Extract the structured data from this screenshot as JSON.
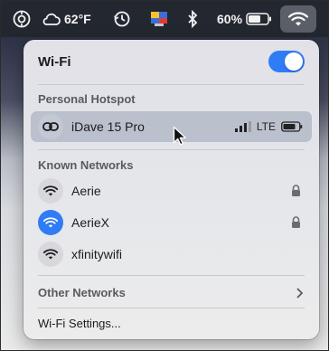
{
  "menubar": {
    "weather": "62°F",
    "battery_percent": "60%",
    "icons": [
      "control-center-icon",
      "weather-cloud-icon",
      "time-machine-icon",
      "menu-app-icon",
      "bluetooth-icon",
      "battery-icon",
      "wifi-icon"
    ]
  },
  "panel": {
    "title": "Wi-Fi",
    "wifi_enabled": true,
    "hotspot_header": "Personal Hotspot",
    "hotspot": {
      "name": "iDave 15 Pro",
      "network_type": "LTE"
    },
    "known_header": "Known Networks",
    "known_networks": [
      {
        "name": "Aerie",
        "locked": true,
        "connected": false
      },
      {
        "name": "AerieX",
        "locked": true,
        "connected": true
      },
      {
        "name": "xfinitywifi",
        "locked": false,
        "connected": false
      }
    ],
    "other_networks": "Other Networks",
    "settings": "Wi-Fi Settings..."
  },
  "colors": {
    "accent": "#2f7cf6",
    "menubar": "#23272f"
  }
}
